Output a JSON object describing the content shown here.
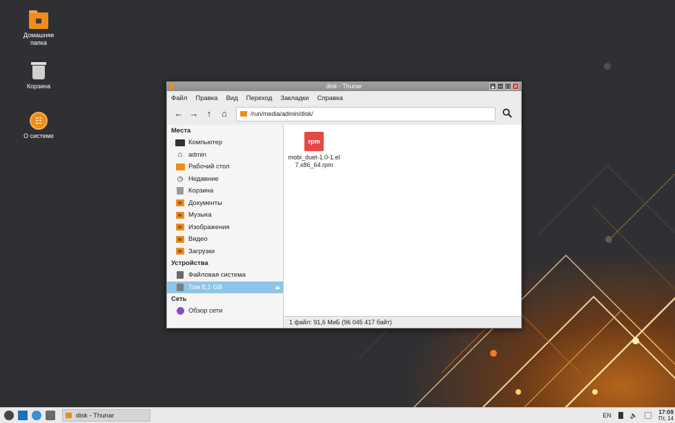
{
  "desktop": {
    "icons": [
      {
        "label": "Домашняя папка"
      },
      {
        "label": "Корзина"
      },
      {
        "label": "О системе"
      }
    ]
  },
  "window": {
    "title": "disk - Thunar",
    "menu": [
      "Файл",
      "Правка",
      "Вид",
      "Переход",
      "Закладки",
      "Справка"
    ],
    "location": "/run/media/admin/disk/",
    "sidebar": {
      "places_header": "Места",
      "places": [
        "Компьютер",
        "admin",
        "Рабочий стол",
        "Недавние",
        "Корзина",
        "Документы",
        "Музыка",
        "Изображения",
        "Видео",
        "Загрузки"
      ],
      "devices_header": "Устройства",
      "devices": [
        "Файловая система",
        "Том 8,1 GB"
      ],
      "network_header": "Сеть",
      "network": [
        "Обзор сети"
      ]
    },
    "files": [
      {
        "badge": "rpm",
        "name": "mobi_duet-1.0-1.el7.x86_64.rpm",
        "line1": "mobi_duet-1.0-1.el",
        "line2": "7.x86_64.rpm"
      }
    ],
    "status": "1 файл: 91,6 МиБ (96 045 417 байт)"
  },
  "taskbar": {
    "task_label": "disk - Thunar",
    "lang": "EN",
    "time": "17:09",
    "date": "Пт, 14"
  },
  "colors": {
    "accent_orange": "#f08c1b",
    "selection": "#8ec5e9",
    "rpm_red": "#e64848"
  }
}
